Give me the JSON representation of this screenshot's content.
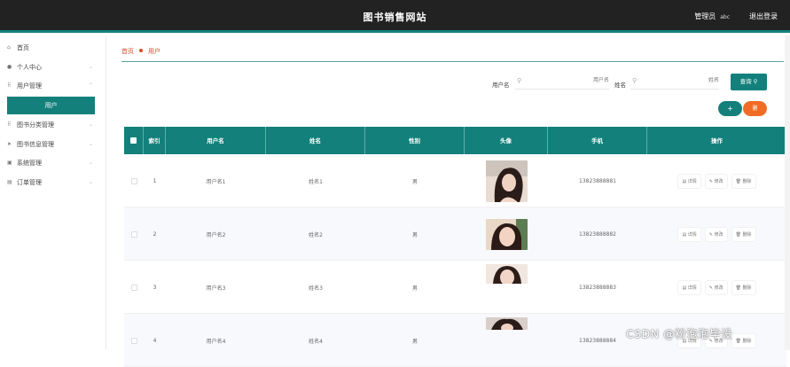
{
  "header": {
    "title": "图书销售网站",
    "admin_label": "管理员",
    "username": "abc",
    "logout": "退出登录"
  },
  "sidebar": {
    "items": [
      {
        "label": "首页",
        "icon": "home-icon"
      },
      {
        "label": "个人中心",
        "icon": "user-icon"
      },
      {
        "label": "用户管理",
        "icon": "grid-icon",
        "sub": "用户"
      },
      {
        "label": "图书分类管理",
        "icon": "grid-icon"
      },
      {
        "label": "图书信息管理",
        "icon": "send-icon"
      },
      {
        "label": "系统管理",
        "icon": "box-icon"
      },
      {
        "label": "订单管理",
        "icon": "list-icon"
      }
    ]
  },
  "breadcrumb": {
    "home": "首页",
    "current": "用户"
  },
  "search": {
    "username_label": "用户名",
    "username_placeholder": "用户名",
    "name_label": "姓名",
    "name_placeholder": "姓名",
    "query_label": "查询"
  },
  "actions": {
    "add": "+",
    "delete": "删"
  },
  "table": {
    "headers": [
      "索引",
      "用户名",
      "姓名",
      "性别",
      "头像",
      "手机",
      "操作"
    ],
    "op_labels": {
      "detail": "详情",
      "edit": "修改",
      "delete": "删除"
    },
    "rows": [
      {
        "index": "1",
        "username": "用户名1",
        "name": "姓名1",
        "gender": "男",
        "phone": "13823888881"
      },
      {
        "index": "2",
        "username": "用户名2",
        "name": "姓名2",
        "gender": "男",
        "phone": "13823888882"
      },
      {
        "index": "3",
        "username": "用户名3",
        "name": "姓名3",
        "gender": "男",
        "phone": "13823888883"
      },
      {
        "index": "4",
        "username": "用户名4",
        "name": "姓名4",
        "gender": "男",
        "phone": "13823888884"
      }
    ]
  },
  "colors": {
    "accent": "#13807b",
    "topbar": "#222222",
    "danger": "#f06b25",
    "crumb": "#d94b2b"
  },
  "watermark": "CSDN @粉泡泡毕设"
}
